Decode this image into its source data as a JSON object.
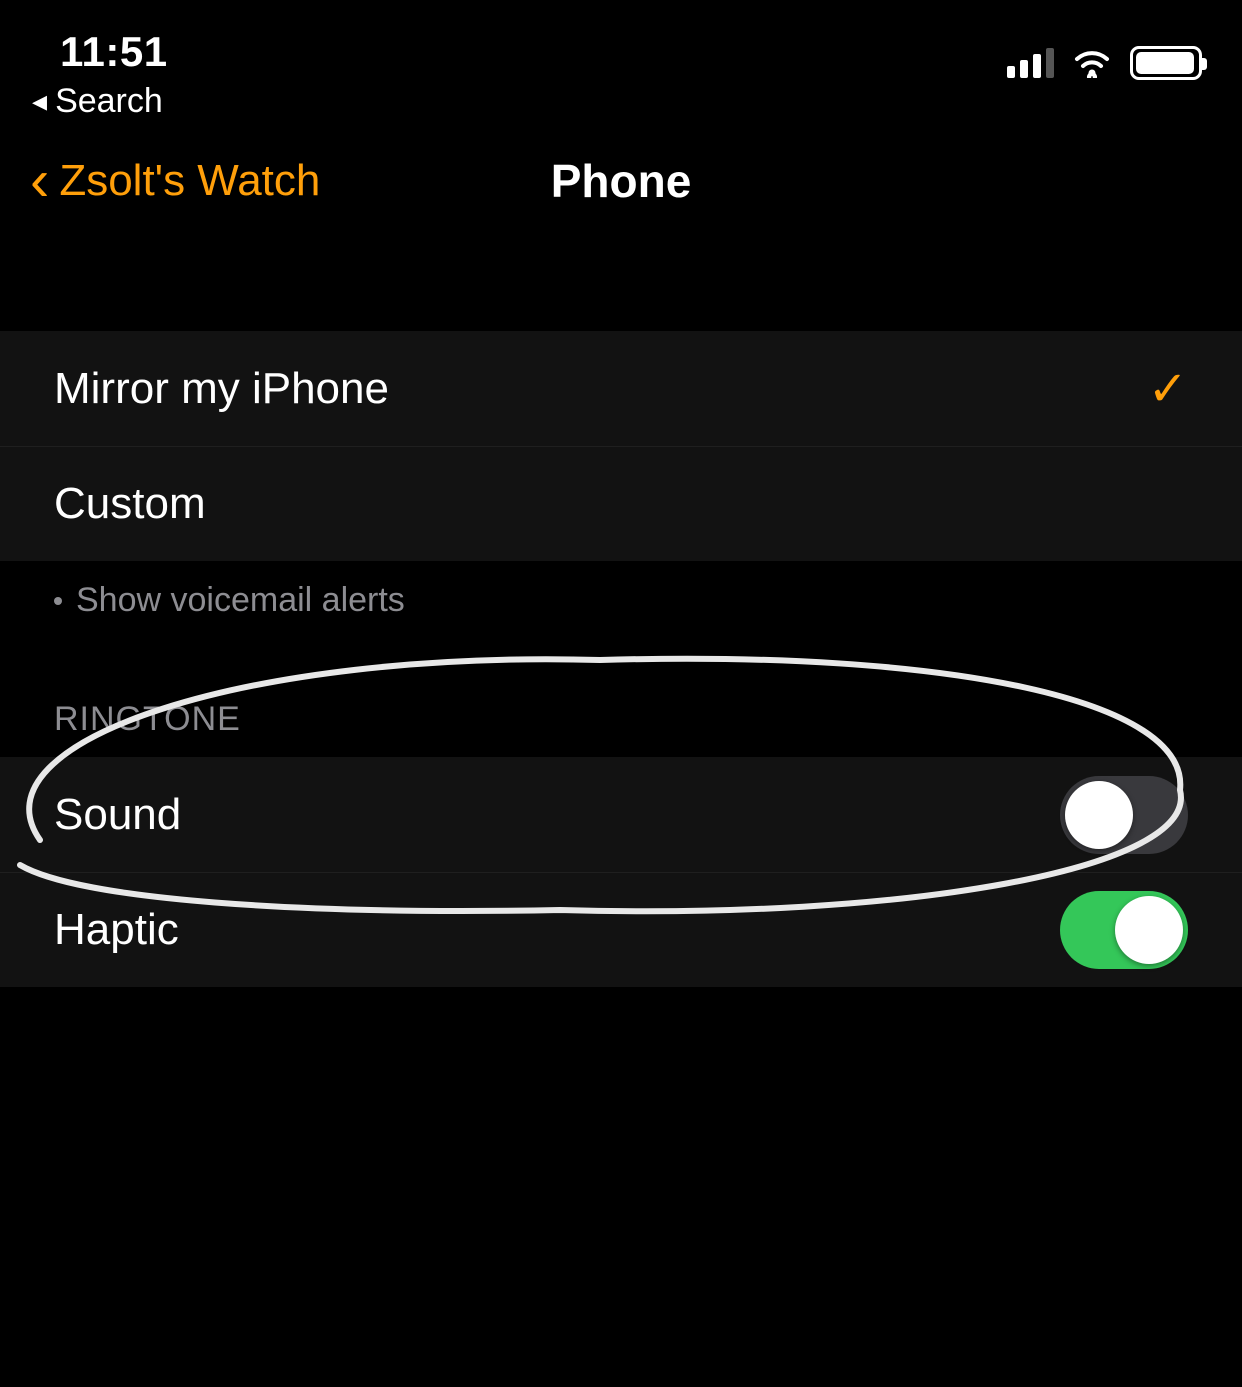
{
  "status": {
    "time": "11:51",
    "breadcrumb": "Search"
  },
  "nav": {
    "back_label": "Zsolt's Watch",
    "title": "Phone"
  },
  "mirror_group": {
    "items": [
      {
        "label": "Mirror my iPhone",
        "selected": true
      },
      {
        "label": "Custom",
        "selected": false
      }
    ],
    "footer": "Show voicemail alerts"
  },
  "ringtone_group": {
    "header": "RINGTONE",
    "items": [
      {
        "label": "Sound",
        "on": false
      },
      {
        "label": "Haptic",
        "on": true
      }
    ]
  },
  "colors": {
    "accent": "#ff9f0a",
    "toggle_on": "#34c759"
  }
}
